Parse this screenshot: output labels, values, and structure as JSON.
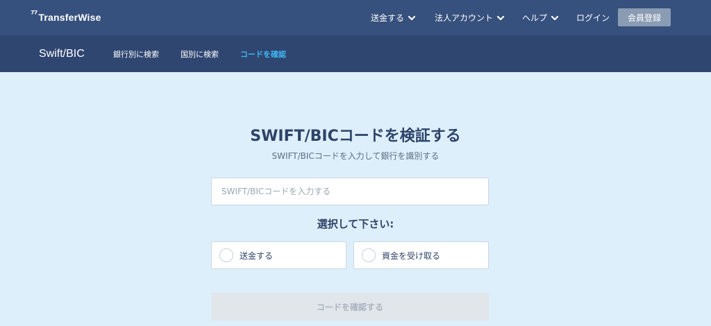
{
  "header": {
    "logo_mark": "⁷⁷",
    "logo_text": "TransferWise",
    "nav": {
      "send": "送金する",
      "business": "法人アカウント",
      "help": "ヘルプ",
      "login": "ログイン",
      "signup": "会員登録"
    }
  },
  "subnav": {
    "brand": "Swift/BIC",
    "links": {
      "by_bank": "銀行別に検索",
      "by_country": "国別に検索",
      "verify": "コードを確認"
    }
  },
  "main": {
    "title": "SWIFT/BICコードを検証する",
    "subtitle": "SWIFT/BICコードを入力して銀行を識別する",
    "input": {
      "placeholder": "SWIFT/BICコードを入力する",
      "value": ""
    },
    "choose_label": "選択して下さい:",
    "options": {
      "send": "送金する",
      "receive": "資金を受け取る"
    },
    "submit_label": "コードを確認する"
  },
  "colors": {
    "header_bg": "#37517e",
    "subnav_bg": "#2f4671",
    "page_bg": "#ddeffa",
    "accent": "#3eb6f1",
    "signup_bg": "#8a9cb3"
  }
}
